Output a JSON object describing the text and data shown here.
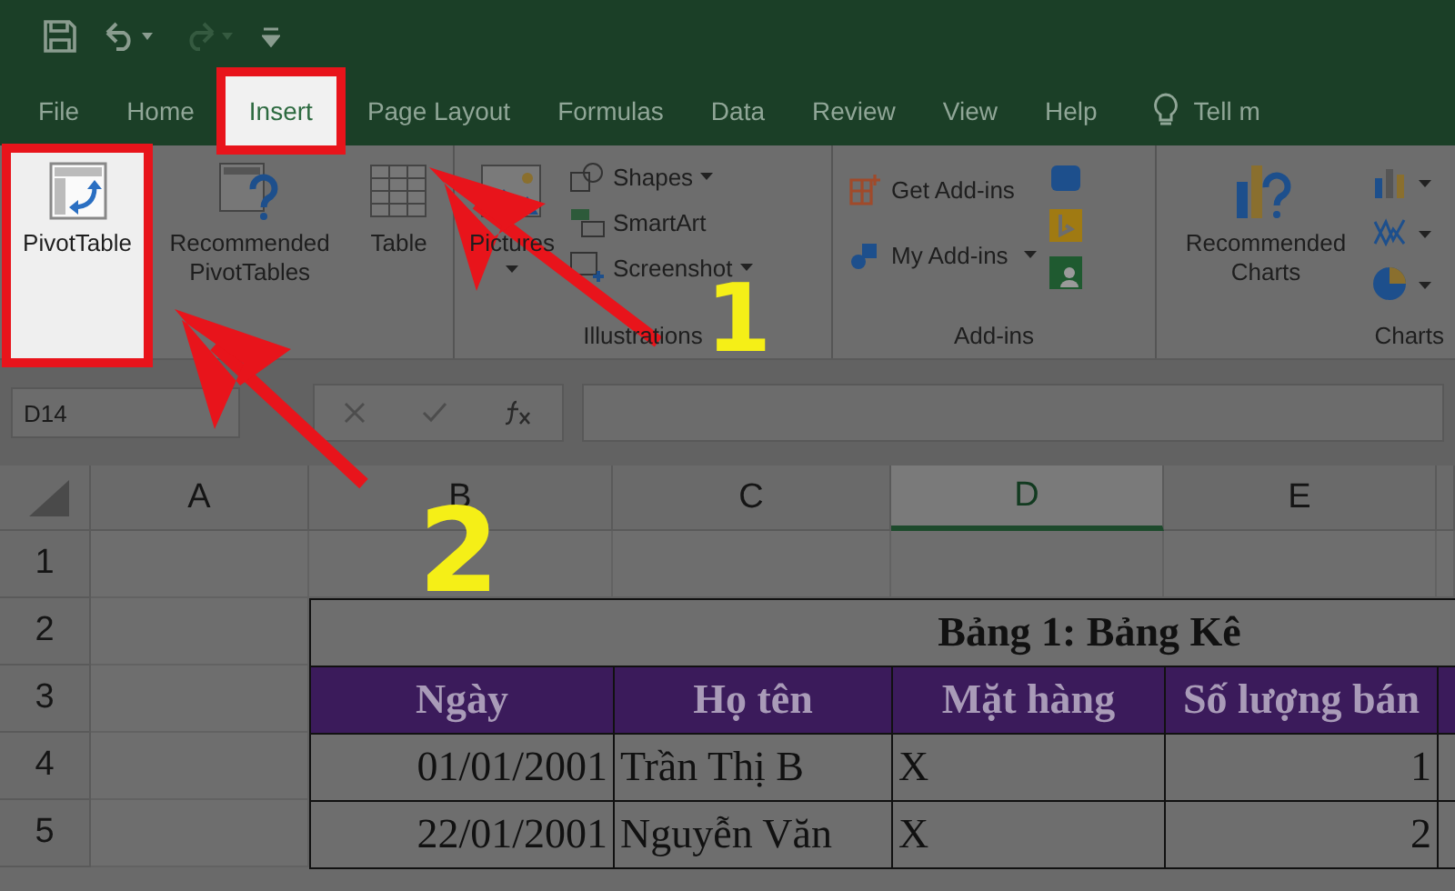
{
  "tabs": [
    {
      "label": "File",
      "selected": false,
      "highlighted": false
    },
    {
      "label": "Home",
      "selected": false,
      "highlighted": false
    },
    {
      "label": "Insert",
      "selected": true,
      "highlighted": true
    },
    {
      "label": "Page Layout",
      "selected": false,
      "highlighted": false
    },
    {
      "label": "Formulas",
      "selected": false,
      "highlighted": false
    },
    {
      "label": "Data",
      "selected": false,
      "highlighted": false
    },
    {
      "label": "Review",
      "selected": false,
      "highlighted": false
    },
    {
      "label": "View",
      "selected": false,
      "highlighted": false
    },
    {
      "label": "Help",
      "selected": false,
      "highlighted": false
    }
  ],
  "tell_me": "Tell m",
  "ribbon": {
    "tables": [
      {
        "label": "PivotTable",
        "highlighted": true
      },
      {
        "label": "Recommended PivotTables",
        "highlighted": false
      },
      {
        "label": "Table",
        "highlighted": false
      }
    ],
    "illustrations": {
      "pictures": "Pictures",
      "items": [
        {
          "label": "Shapes",
          "dropdown": true
        },
        {
          "label": "SmartArt",
          "dropdown": false
        },
        {
          "label": "Screenshot",
          "dropdown": true
        }
      ],
      "label": "Illustrations"
    },
    "addins": {
      "items": [
        {
          "label": "Get Add-ins",
          "dropdown": false
        },
        {
          "label": "My Add-ins",
          "dropdown": true
        }
      ],
      "label": "Add-ins"
    },
    "charts": {
      "recommended": "Recommended Charts",
      "label": "Charts"
    }
  },
  "formula_bar": {
    "name_box": "D14"
  },
  "sheet": {
    "columns": [
      {
        "label": "A",
        "selected": false
      },
      {
        "label": "B",
        "selected": false
      },
      {
        "label": "C",
        "selected": false
      },
      {
        "label": "D",
        "selected": true
      },
      {
        "label": "E",
        "selected": false
      }
    ],
    "row_headers": [
      "1",
      "2",
      "3",
      "4",
      "5"
    ],
    "title": "Bảng 1: Bảng Kê",
    "table_header": [
      "Ngày",
      "Họ tên",
      "Mặt hàng",
      "Số lượng bán"
    ],
    "table_rows": [
      [
        "01/01/2001",
        "Trần Thị B",
        "X",
        "1"
      ],
      [
        "22/01/2001",
        "Nguyễn Văn",
        "X",
        "2"
      ]
    ]
  },
  "annotations": [
    "1",
    "2"
  ]
}
